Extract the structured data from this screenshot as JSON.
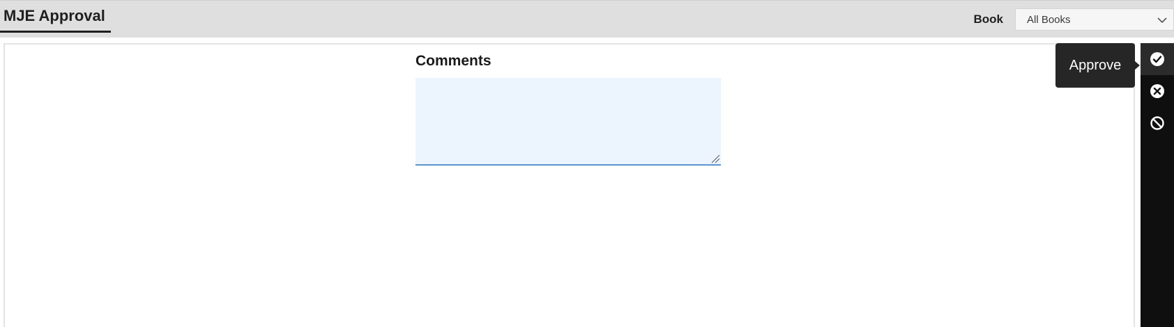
{
  "header": {
    "tab_label": "MJE Approval",
    "book_label": "Book",
    "book_select": {
      "selected": "All Books",
      "icon": "chevron-down-icon"
    }
  },
  "form": {
    "comments_label": "Comments",
    "comments_value": ""
  },
  "sidebar": {
    "actions": [
      {
        "name": "approve",
        "icon": "check-circle-icon"
      },
      {
        "name": "reject",
        "icon": "close-circle-icon"
      },
      {
        "name": "cancel",
        "icon": "block-icon"
      }
    ],
    "tooltip": "Approve"
  },
  "colors": {
    "header_bg": "#dfdfdf",
    "sidebar_bg": "#0f0f0f",
    "textarea_bg": "#ecf4fd",
    "textarea_underline": "#5b93d3",
    "tooltip_bg": "#262626"
  }
}
